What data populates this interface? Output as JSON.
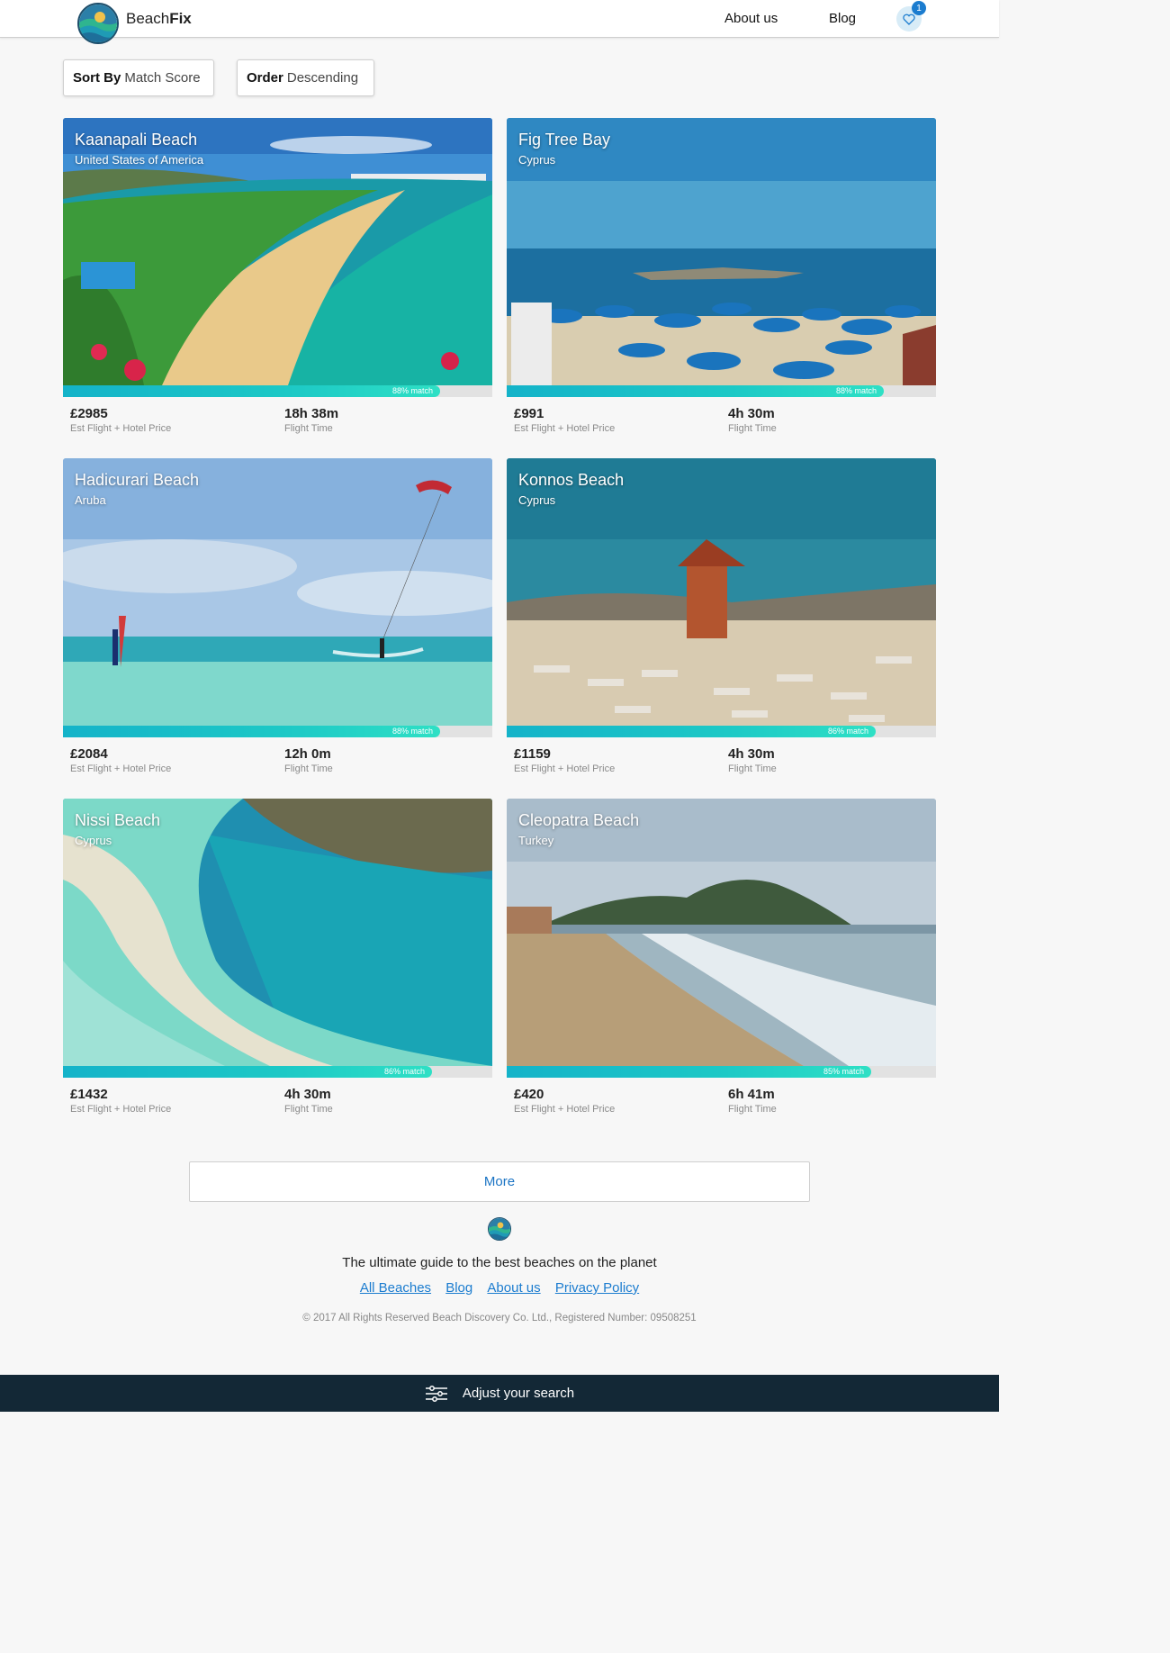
{
  "header": {
    "brand_light": "Beach",
    "brand_bold": "Fix",
    "nav": {
      "about": "About us",
      "blog": "Blog"
    },
    "favorites_count": "1"
  },
  "sort": {
    "sort_by_label": "Sort By",
    "sort_by_value": "Match Score",
    "order_label": "Order",
    "order_value": "Descending"
  },
  "labels": {
    "price_label": "Est Flight + Hotel Price",
    "time_label": "Flight Time"
  },
  "beaches": [
    {
      "name": "Kaanapali Beach",
      "country": "United States of America",
      "match": 88,
      "match_text": "88% match",
      "price": "£2985",
      "flight_time": "18h 38m"
    },
    {
      "name": "Fig Tree Bay",
      "country": "Cyprus",
      "match": 88,
      "match_text": "88% match",
      "price": "£991",
      "flight_time": "4h 30m"
    },
    {
      "name": "Hadicurari Beach",
      "country": "Aruba",
      "match": 88,
      "match_text": "88% match",
      "price": "£2084",
      "flight_time": "12h 0m"
    },
    {
      "name": "Konnos Beach",
      "country": "Cyprus",
      "match": 86,
      "match_text": "86% match",
      "price": "£1159",
      "flight_time": "4h 30m"
    },
    {
      "name": "Nissi Beach",
      "country": "Cyprus",
      "match": 86,
      "match_text": "86% match",
      "price": "£1432",
      "flight_time": "4h 30m"
    },
    {
      "name": "Cleopatra Beach",
      "country": "Turkey",
      "match": 85,
      "match_text": "85% match",
      "price": "£420",
      "flight_time": "6h 41m"
    }
  ],
  "more_label": "More",
  "footer": {
    "tagline": "The ultimate guide to the best beaches on the planet",
    "links": [
      "All Beaches",
      "Blog",
      "About us",
      "Privacy Policy"
    ],
    "copyright": "© 2017 All Rights Reserved Beach Discovery Co. Ltd., Registered Number: 09508251"
  },
  "adjust_search_label": "Adjust your search",
  "colors": {
    "accent": "#1b7ccf",
    "match_bar": "#1dc9c6",
    "bottom_bar": "#132836"
  },
  "icons": {
    "favorites": "heart-icon",
    "adjust": "sliders-icon"
  }
}
